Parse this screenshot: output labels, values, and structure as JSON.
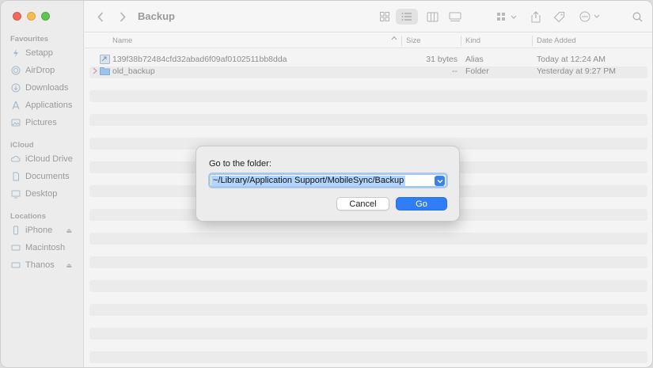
{
  "window": {
    "title": "Backup"
  },
  "sidebar": {
    "sections": [
      {
        "label": "Favourites",
        "items": [
          {
            "label": "Setapp",
            "icon": "setapp-icon"
          },
          {
            "label": "AirDrop",
            "icon": "airdrop-icon"
          },
          {
            "label": "Downloads",
            "icon": "downloads-icon"
          },
          {
            "label": "Applications",
            "icon": "applications-icon"
          },
          {
            "label": "Pictures",
            "icon": "pictures-icon"
          }
        ]
      },
      {
        "label": "iCloud",
        "items": [
          {
            "label": "iCloud Drive",
            "icon": "cloud-icon"
          },
          {
            "label": "Documents",
            "icon": "document-icon"
          },
          {
            "label": "Desktop",
            "icon": "desktop-icon"
          }
        ]
      },
      {
        "label": "Locations",
        "items": [
          {
            "label": "iPhone",
            "icon": "iphone-icon",
            "eject": true
          },
          {
            "label": "Macintosh",
            "icon": "disk-icon"
          },
          {
            "label": "Thanos",
            "icon": "disk-icon",
            "eject": true
          }
        ]
      }
    ]
  },
  "columns": {
    "name": "Name",
    "size": "Size",
    "kind": "Kind",
    "date": "Date Added"
  },
  "files": [
    {
      "name": "139f38b72484cfd32abad6f09af0102511bb8dda",
      "size": "31 bytes",
      "kind": "Alias",
      "date": "Today at 12:24 AM",
      "icon": "alias-file-icon"
    },
    {
      "name": "old_backup",
      "size": "--",
      "kind": "Folder",
      "date": "Yesterday at 9:27 PM",
      "icon": "folder-icon"
    }
  ],
  "dialog": {
    "label": "Go to the folder:",
    "path": "~/Library/Application Support/MobileSync/Backup",
    "cancel": "Cancel",
    "go": "Go"
  },
  "colors": {
    "accent": "#2f7ef6",
    "selection": "#b3d4fc"
  }
}
